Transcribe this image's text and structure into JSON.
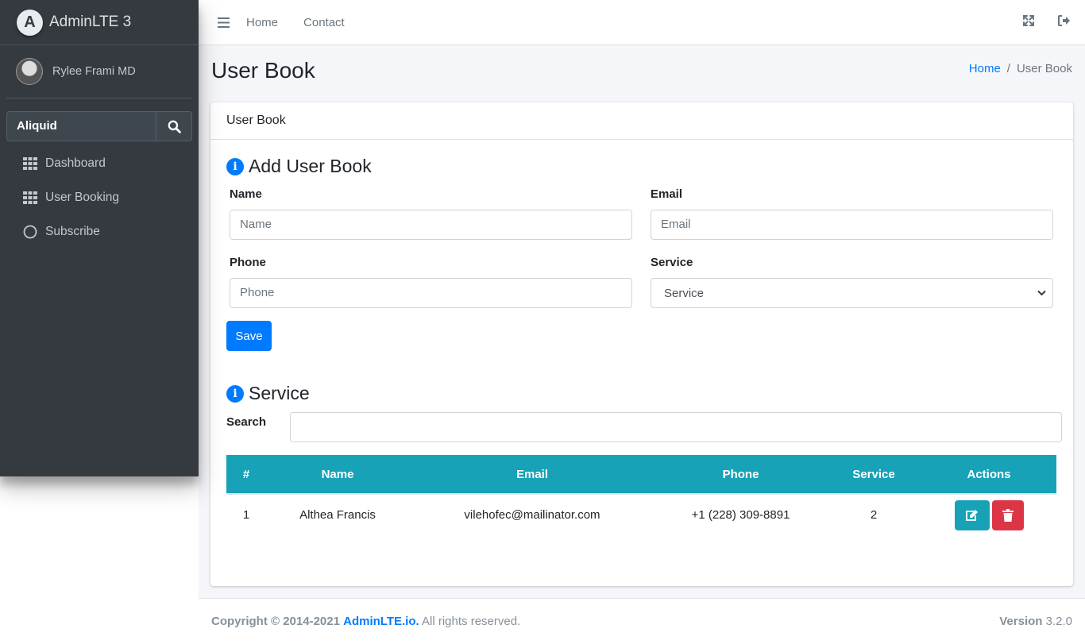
{
  "sidebar": {
    "brand": "AdminLTE 3",
    "user_name": "Rylee Frami MD",
    "search_value": "Aliquid",
    "items": [
      {
        "label": "Dashboard"
      },
      {
        "label": "User Booking"
      },
      {
        "label": "Subscribe"
      }
    ]
  },
  "navbar": {
    "links": [
      "Home",
      "Contact"
    ]
  },
  "page": {
    "title": "User Book",
    "breadcrumb": [
      "Home",
      "User Book"
    ]
  },
  "card": {
    "header": "User Book",
    "form_title": "Add User Book",
    "fields": {
      "name_label": "Name",
      "name_placeholder": "Name",
      "email_label": "Email",
      "email_placeholder": "Email",
      "phone_label": "Phone",
      "phone_placeholder": "Phone",
      "service_label": "Service",
      "service_selected": "Service"
    },
    "save_label": "Save",
    "list_title": "Service",
    "search_label": "Search",
    "search_value": "",
    "table": {
      "headers": [
        "#",
        "Name",
        "Email",
        "Phone",
        "Service",
        "Actions"
      ],
      "rows": [
        {
          "num": "1",
          "name": "Althea Francis",
          "email": "vilehofec@mailinator.com",
          "phone": "+1 (228) 309-8891",
          "service": "2"
        }
      ]
    }
  },
  "footer": {
    "copyright": "Copyright © 2014-2021",
    "brand_link": "AdminLTE.io.",
    "rights": "All rights reserved.",
    "version_label": "Version",
    "version": "3.2.0"
  },
  "colors": {
    "primary": "#007bff",
    "info": "#17a2b8",
    "danger": "#dc3545",
    "sidebar": "#343a40"
  }
}
